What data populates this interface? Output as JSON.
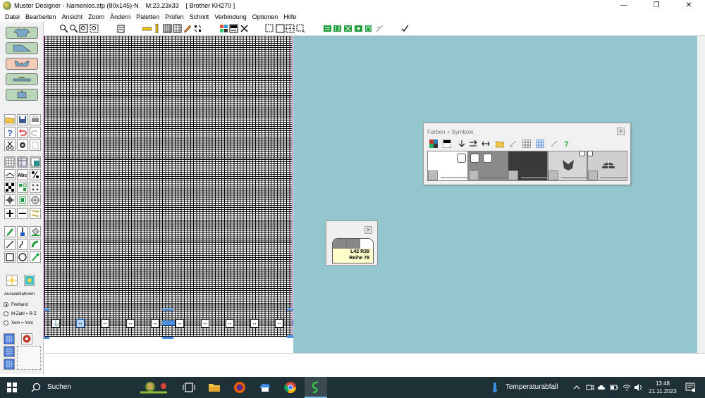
{
  "window": {
    "title": "Muster Designer - Namenlos.stp (80x145)-N    M:23.23x33    [ Brother KH270 ]",
    "minimize": "—",
    "maximize": "❐",
    "close": "✕"
  },
  "menu": [
    "Datei",
    "Bearbeiten",
    "Ansicht",
    "Zoom",
    "Ändern",
    "Paletten",
    "Prüfen",
    "Schnitt",
    "Verbindung",
    "Optionen",
    "Hilfe"
  ],
  "left_panel": {
    "auswahlrahmen_label": "Auswahlrahmen",
    "radio_options": [
      {
        "label": "Freihand",
        "selected": true
      },
      {
        "label": "M-Zahl = R-Z",
        "selected": false
      },
      {
        "label": "Xom = Yom",
        "selected": false
      }
    ]
  },
  "farben_dialog": {
    "title": "Farben + Symbole",
    "close": "x"
  },
  "position_dialog": {
    "close": "x",
    "line1": "L42 R39",
    "line2": "Reihe 78"
  },
  "taskbar": {
    "search_label": "Suchen",
    "weather": "Temperaturabfall",
    "time": "13:48",
    "date": "21.11.2023"
  },
  "colors": {
    "workspace": "#93c6cf",
    "grid_border": "#c35bc3",
    "taskbar": "#1f3036",
    "selection_blue": "#4a90e2"
  }
}
